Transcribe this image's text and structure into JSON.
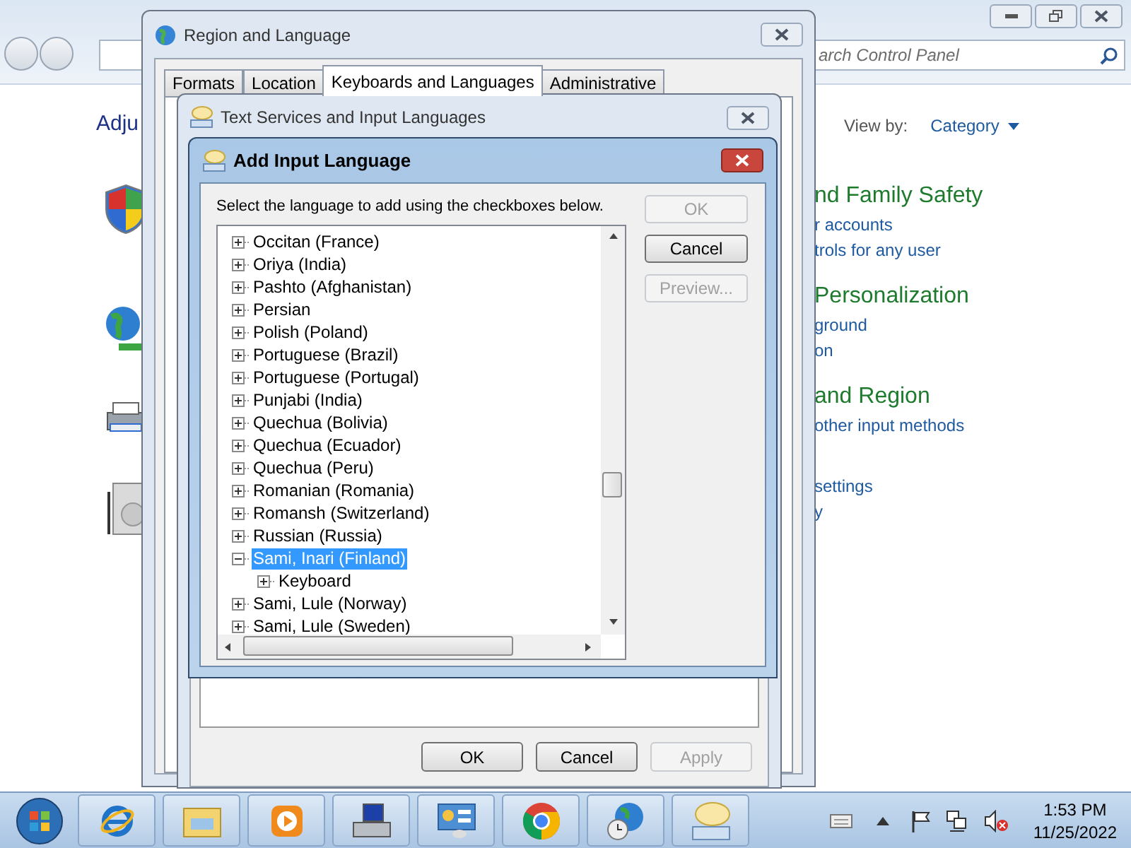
{
  "control_panel": {
    "search_placeholder": "arch Control Panel",
    "heading": "Adju",
    "view_by_label": "View by:",
    "view_by_value": "Category",
    "categories": [
      {
        "title": "nd Family Safety",
        "links": [
          "r accounts",
          "trols for any user"
        ]
      },
      {
        "title": "Personalization",
        "links": [
          "ground",
          "on"
        ]
      },
      {
        "title": "and Region",
        "links": [
          "other input methods"
        ]
      },
      {
        "links": [
          "settings",
          "y"
        ]
      }
    ]
  },
  "region_dialog": {
    "title": "Region and Language",
    "tabs": [
      {
        "label": "Formats",
        "selected": false
      },
      {
        "label": "Location",
        "selected": false
      },
      {
        "label": "Keyboards and Languages",
        "selected": true
      },
      {
        "label": "Administrative",
        "selected": false
      }
    ]
  },
  "text_services_dialog": {
    "title": "Text Services and Input Languages",
    "buttons": [
      {
        "label": "OK",
        "disabled": false
      },
      {
        "label": "Cancel",
        "disabled": false
      },
      {
        "label": "Apply",
        "disabled": true
      }
    ]
  },
  "add_input_dialog": {
    "title": "Add Input Language",
    "instruction": "Select the language to add using the checkboxes below.",
    "tree": [
      {
        "label": "Occitan (France)",
        "expanded": false,
        "selected": false
      },
      {
        "label": "Oriya (India)",
        "expanded": false,
        "selected": false
      },
      {
        "label": "Pashto (Afghanistan)",
        "expanded": false,
        "selected": false
      },
      {
        "label": "Persian",
        "expanded": false,
        "selected": false
      },
      {
        "label": "Polish (Poland)",
        "expanded": false,
        "selected": false
      },
      {
        "label": "Portuguese (Brazil)",
        "expanded": false,
        "selected": false
      },
      {
        "label": "Portuguese (Portugal)",
        "expanded": false,
        "selected": false
      },
      {
        "label": "Punjabi (India)",
        "expanded": false,
        "selected": false
      },
      {
        "label": "Quechua (Bolivia)",
        "expanded": false,
        "selected": false
      },
      {
        "label": "Quechua (Ecuador)",
        "expanded": false,
        "selected": false
      },
      {
        "label": "Quechua (Peru)",
        "expanded": false,
        "selected": false
      },
      {
        "label": "Romanian (Romania)",
        "expanded": false,
        "selected": false
      },
      {
        "label": "Romansh (Switzerland)",
        "expanded": false,
        "selected": false
      },
      {
        "label": "Russian (Russia)",
        "expanded": false,
        "selected": false
      },
      {
        "label": "Sami, Inari (Finland)",
        "expanded": true,
        "selected": true,
        "children": [
          {
            "label": "Keyboard",
            "expanded": false,
            "selected": false
          }
        ]
      },
      {
        "label": "Sami, Lule (Norway)",
        "expanded": false,
        "selected": false
      },
      {
        "label": "Sami, Lule (Sweden)",
        "expanded": false,
        "selected": false
      }
    ],
    "buttons": [
      {
        "label": "OK",
        "disabled": true
      },
      {
        "label": "Cancel",
        "disabled": false
      },
      {
        "label": "Preview...",
        "disabled": true
      }
    ]
  },
  "taskbar": {
    "time": "1:53 PM",
    "date": "11/25/2022"
  }
}
